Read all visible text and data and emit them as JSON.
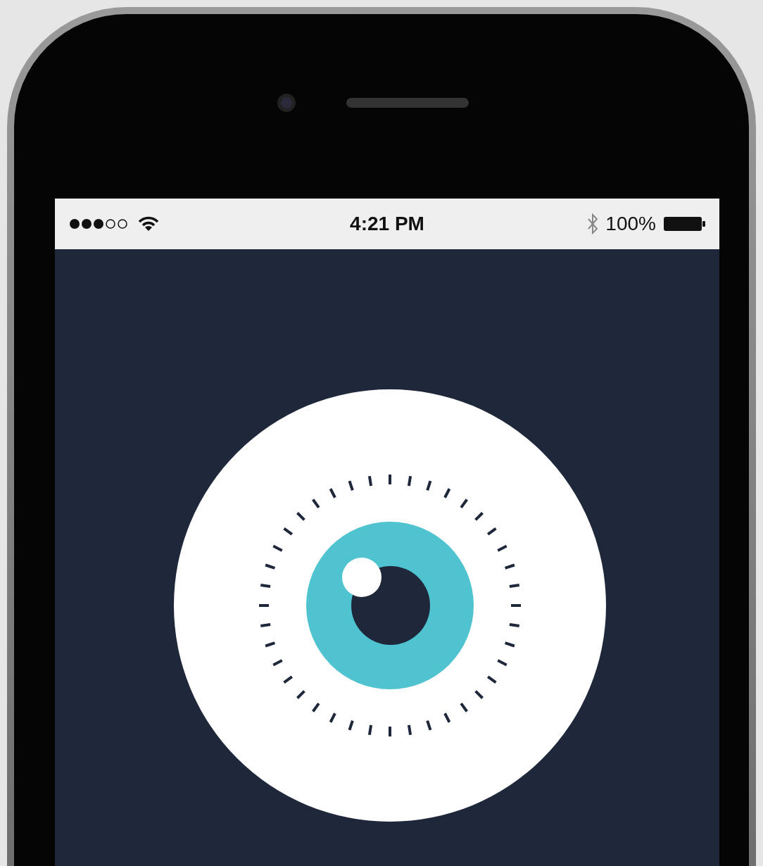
{
  "status_bar": {
    "time": "4:21 PM",
    "battery": "100%"
  }
}
